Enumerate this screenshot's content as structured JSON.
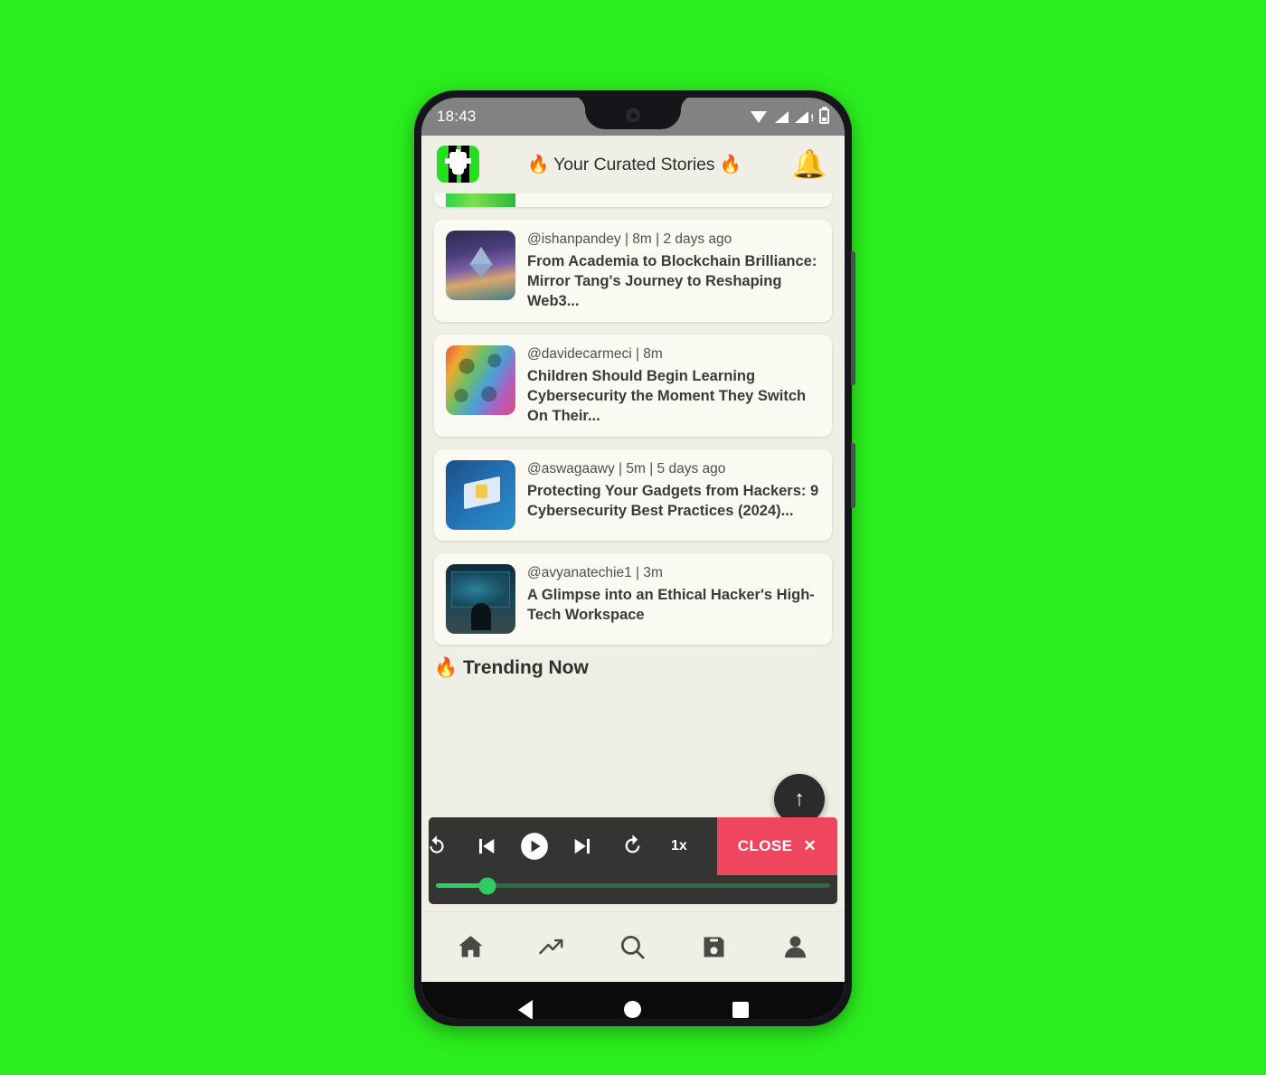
{
  "background_color": "#2bee1e",
  "status_bar": {
    "time": "18:43",
    "icons": [
      "wifi-icon",
      "signal-icon",
      "signal-warning-icon",
      "battery-icon"
    ]
  },
  "app_bar": {
    "logo_name": "hackernoon-logo",
    "title": "🔥 Your Curated Stories 🔥",
    "notification_icon": "bell-icon",
    "notification_badge": "!"
  },
  "feed": {
    "partial_card_top": {
      "thumb": "green-thumb"
    },
    "cards": [
      {
        "meta": "@ishanpandey | 8m | 2 days ago",
        "title": "From Academia to Blockchain Brilliance: Mirror Tang's Journey to Reshaping Web3...",
        "thumb": "th-eth"
      },
      {
        "meta": "@davidecarmeci | 8m",
        "title": "Children Should Begin Learning Cybersecurity the Moment They Switch On Their...",
        "thumb": "th-kids"
      },
      {
        "meta": "@aswagaawy | 5m | 5 days ago",
        "title": "Protecting Your Gadgets from Hackers: 9 Cybersecurity Best Practices (2024)...",
        "thumb": "th-lock"
      },
      {
        "meta": "@avyanatechie1 | 3m",
        "title": "A Glimpse into an Ethical Hacker's High-Tech Workspace",
        "thumb": "th-hack"
      }
    ],
    "section_heading": "🔥 Trending Now",
    "fab_icon": "arrow-up-icon",
    "fab_label": "↑"
  },
  "player": {
    "buttons": [
      {
        "name": "replay-button",
        "icon": "replay-icon"
      },
      {
        "name": "previous-button",
        "icon": "skip-previous-icon"
      },
      {
        "name": "play-button",
        "icon": "play-icon"
      },
      {
        "name": "next-button",
        "icon": "skip-next-icon"
      },
      {
        "name": "forward-button",
        "icon": "redo-icon"
      }
    ],
    "speed": "1x",
    "close_label": "CLOSE",
    "close_icon": "close-icon",
    "progress_percent": 13,
    "accent_color": "#2ecc62",
    "close_color": "#f0455f"
  },
  "bottom_nav": {
    "items": [
      {
        "name": "nav-home",
        "icon": "home-icon"
      },
      {
        "name": "nav-trending",
        "icon": "trending-up-icon"
      },
      {
        "name": "nav-search",
        "icon": "search-icon"
      },
      {
        "name": "nav-saved",
        "icon": "floppy-disk-icon"
      },
      {
        "name": "nav-profile",
        "icon": "person-icon"
      }
    ]
  },
  "android_nav": {
    "items": [
      {
        "name": "android-back",
        "icon": "back-triangle-icon"
      },
      {
        "name": "android-home",
        "icon": "home-circle-icon"
      },
      {
        "name": "android-recents",
        "icon": "recents-square-icon"
      }
    ]
  }
}
